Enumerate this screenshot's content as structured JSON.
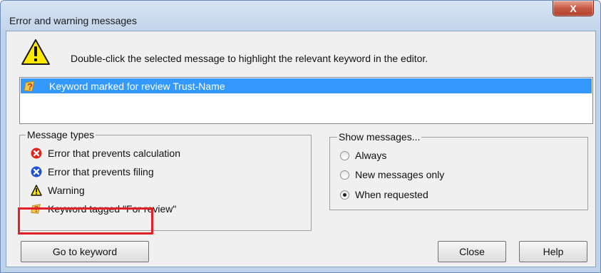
{
  "window": {
    "title": "Error and warning messages",
    "close_glyph": "X"
  },
  "intro": {
    "text": "Double-click the selected message to highlight the relevant keyword in the editor.",
    "icon": "warning-large-icon"
  },
  "messages": [
    {
      "text": "Keyword marked for review Trust-Name",
      "icon": "review-keyword-icon",
      "selected": true
    }
  ],
  "message_types": {
    "label": "Message types",
    "items": [
      {
        "text": "Error that prevents calculation",
        "icon": "error-red-icon"
      },
      {
        "text": "Error that prevents filing",
        "icon": "error-blue-icon"
      },
      {
        "text": "Warning",
        "icon": "warning-icon"
      },
      {
        "text": "Keyword tagged \"For review\"",
        "icon": "review-keyword-icon"
      }
    ]
  },
  "show_messages": {
    "label": "Show messages...",
    "options": [
      {
        "text": "Always",
        "checked": false
      },
      {
        "text": "New messages only",
        "checked": false
      },
      {
        "text": "When requested",
        "checked": true
      }
    ]
  },
  "buttons": {
    "goto": "Go to keyword",
    "close": "Close",
    "help": "Help"
  },
  "colors": {
    "selection": "#3399ff",
    "highlight_box": "#e21f26",
    "frame": "#bfd3ea"
  }
}
